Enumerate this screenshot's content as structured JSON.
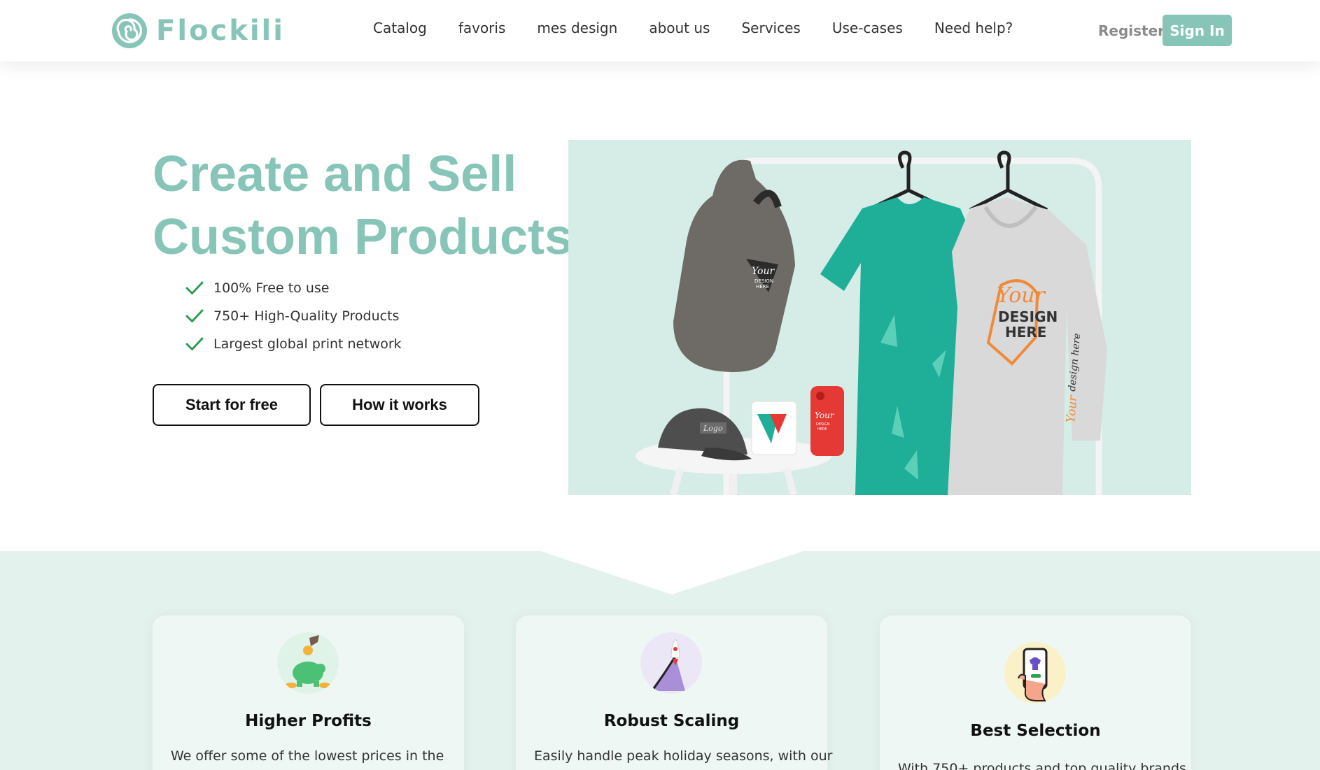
{
  "brand": {
    "name": "Flockili",
    "accent": "#86c5b8"
  },
  "nav": {
    "links": [
      "Catalog",
      "favoris",
      "mes design",
      "about us",
      "Services",
      "Use-cases",
      "Need help?"
    ],
    "register": "Register",
    "signin": "Sign In"
  },
  "hero": {
    "title_line1": "Create and Sell",
    "title_line2": "Custom Products",
    "features": [
      "100% Free to use",
      "750+ High-Quality Products",
      "Largest global print network"
    ],
    "start_button": "Start for free",
    "how_button": "How it works",
    "image": {
      "backpack_print": [
        "Your",
        "DESIGN",
        "HERE"
      ],
      "cap_print": "Logo",
      "case_print": [
        "Your",
        "DESIGN",
        "HERE"
      ],
      "hoodie_print": [
        "Your",
        "DESIGN",
        "HERE"
      ],
      "sleeve_print": [
        "Your",
        "design here"
      ]
    }
  },
  "benefits": [
    {
      "icon": "piggy-bank-icon",
      "title": "Higher Profits",
      "text": "We offer some of the lowest prices in the"
    },
    {
      "icon": "rocket-growth-icon",
      "title": "Robust Scaling",
      "text": "Easily handle peak holiday seasons, with our"
    },
    {
      "icon": "phone-shopping-icon",
      "title": "Best Selection",
      "text": "With 750+ products and top quality brands"
    }
  ]
}
